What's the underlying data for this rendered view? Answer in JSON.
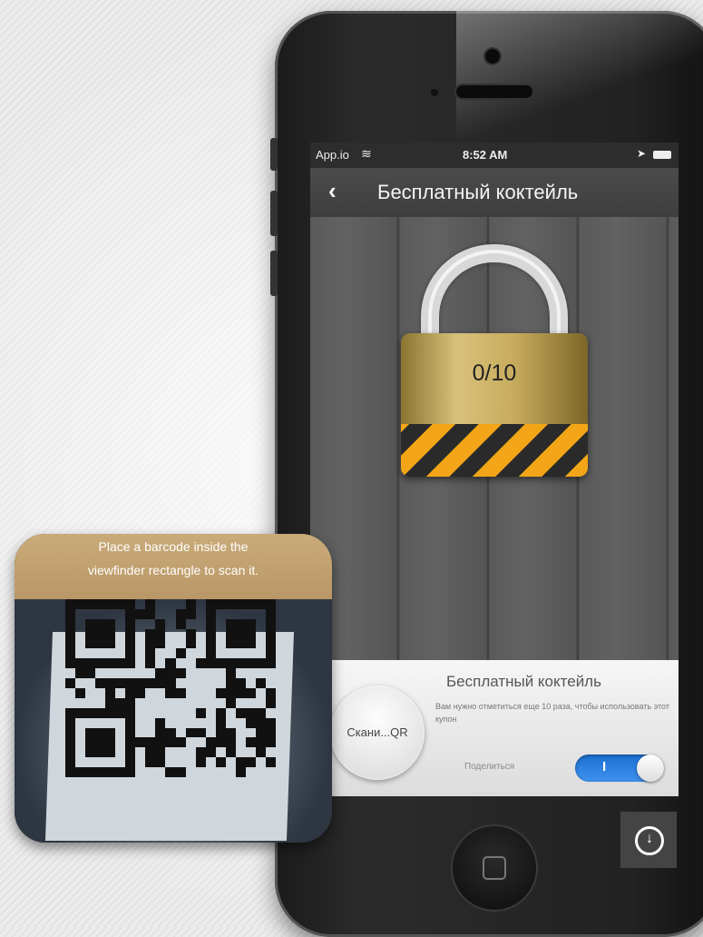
{
  "status_bar": {
    "carrier": "App.io",
    "wifi_icon": "wifi-icon",
    "time": "8:52 AM",
    "location_icon": "location-arrow-icon",
    "battery_icon": "battery-icon"
  },
  "nav": {
    "back_glyph": "‹",
    "title": "Бесплатный коктейль"
  },
  "lock": {
    "counter": "0/10"
  },
  "panel": {
    "scan_button": "Скани...QR",
    "title": "Бесплатный коктейль",
    "description": "Вам нужно отметиться еще 10 раза, чтобы использовать этот купон",
    "share_label": "Поделиться",
    "toggle_on_label": "I"
  },
  "scanner": {
    "instruction_line1": "Place a barcode inside the",
    "instruction_line2": "viewfinder rectangle to scan it."
  },
  "download": {
    "icon": "download-circle-icon"
  },
  "colors": {
    "toggle": "#1b6fd0",
    "stripe_yellow": "#f2a516",
    "stripe_dark": "#2a2a2a",
    "navbar": "#3e3e3e"
  }
}
